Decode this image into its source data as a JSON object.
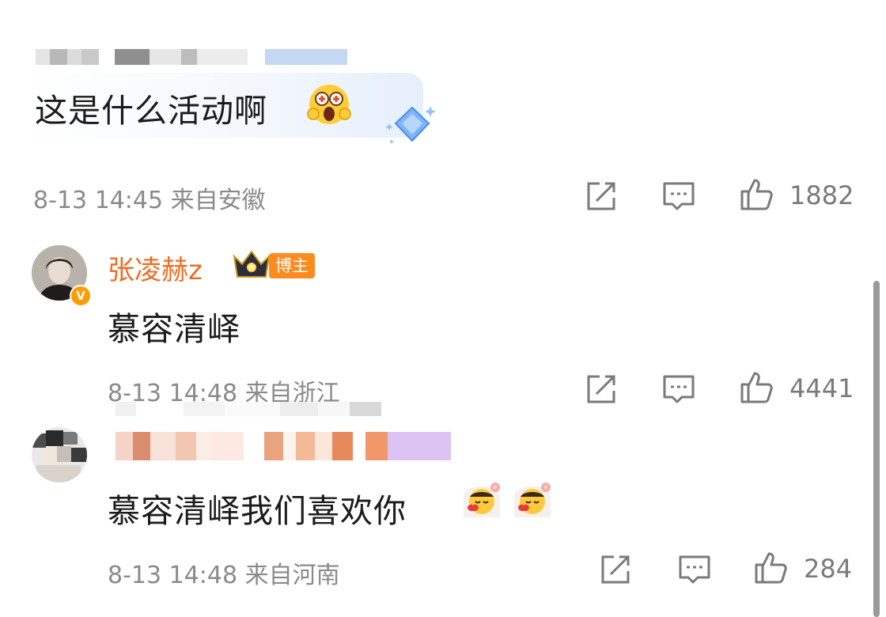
{
  "comments": [
    {
      "text": "这是什么活动啊",
      "date_time": "8-13 14:45",
      "location": "来自安徽",
      "likes": "1882"
    },
    {
      "author": "张凌赫z",
      "badge": "博主",
      "verified_mark": "V",
      "text": "慕容清峄",
      "date_time": "8-13 14:48",
      "location": "来自浙江",
      "likes": "4441"
    },
    {
      "text": "慕容清峄我们喜欢你",
      "date_time": "8-13 14:48",
      "location": "来自河南",
      "likes": "284"
    }
  ],
  "icons": {
    "share": "share-icon",
    "comment": "comment-icon",
    "like": "thumbs-up-icon",
    "emoji_astonished": "astonished-emoji-icon",
    "emoji_veil_heart": "veil-heart-emoji-icon",
    "diamond": "diamond-icon",
    "crown": "crown-icon"
  },
  "colors": {
    "author_name": "#f26a1f",
    "badge_bg": "#ff8a1e",
    "meta_text": "#8a8a8a",
    "icon_gray": "#7a7a7a"
  }
}
